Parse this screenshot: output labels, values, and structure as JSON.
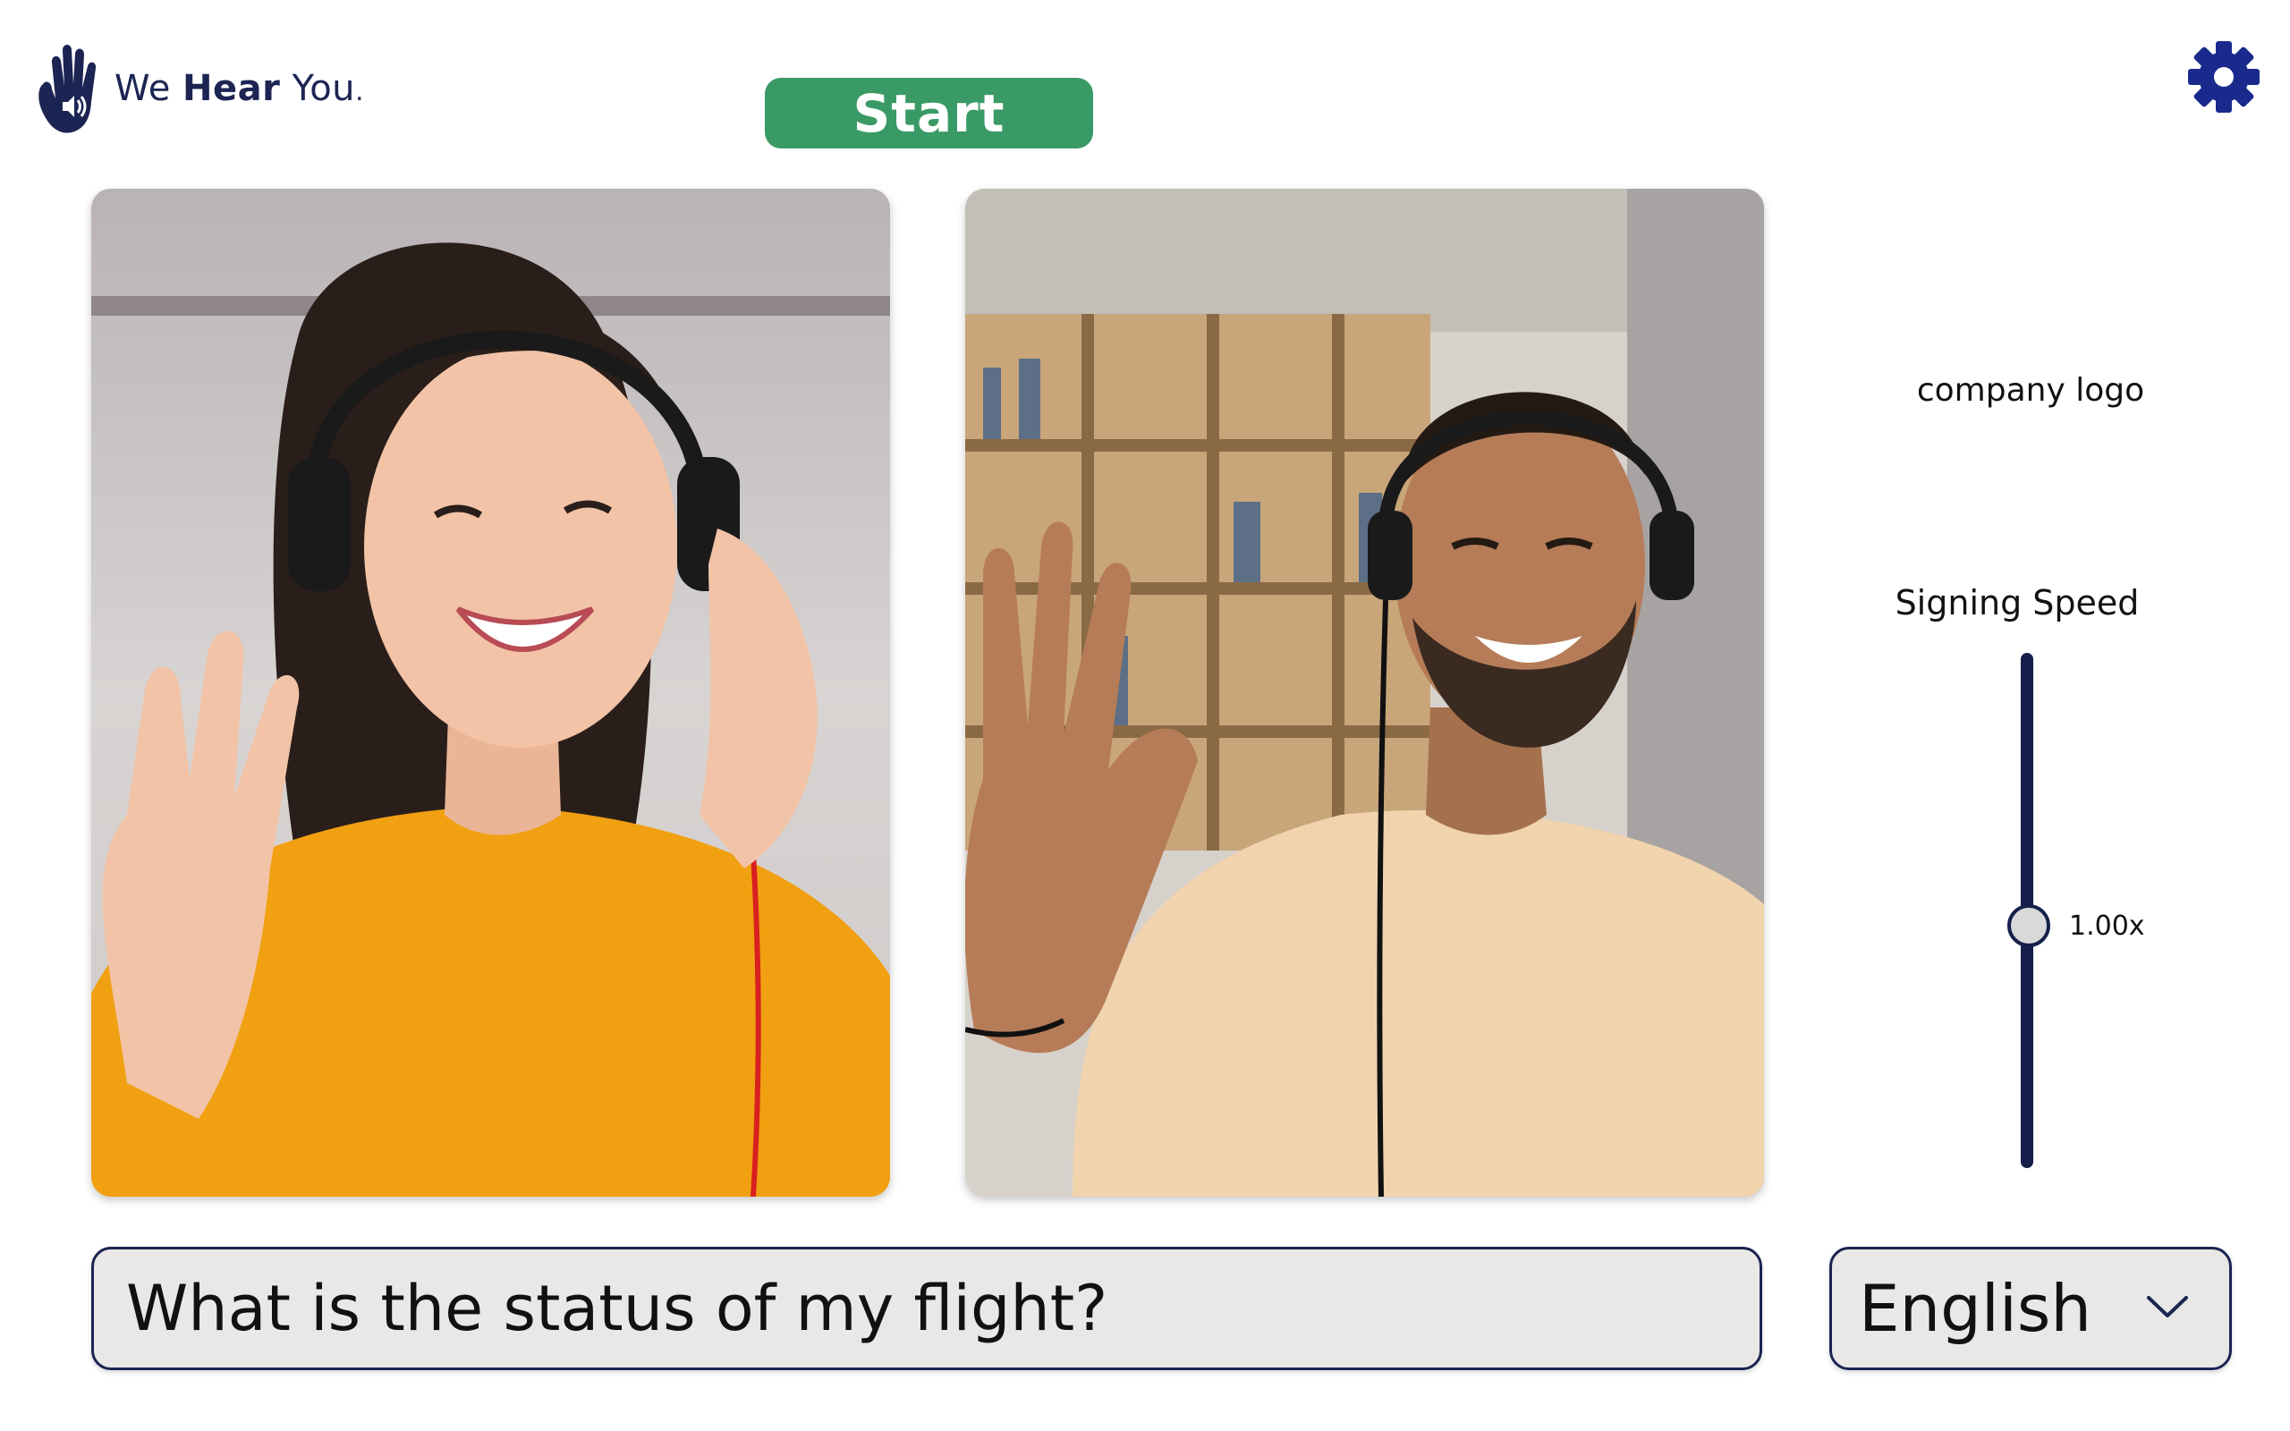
{
  "brand": {
    "name_prefix": "We ",
    "name_strong": "Hear",
    "name_suffix": " You",
    "name_dot": ".",
    "color": "#1b2452"
  },
  "toolbar": {
    "start_label": "Start",
    "start_color": "#3a9a66",
    "settings_icon": "gear-icon",
    "settings_color": "#1a2a8c"
  },
  "videos": {
    "left": {
      "description_icon": "video-feed-woman-headset"
    },
    "right": {
      "description_icon": "video-feed-man-headset"
    }
  },
  "side_panel": {
    "company_logo_label": "company logo",
    "speed_title": "Signing Speed",
    "speed_value": "1.00x",
    "speed_level_fraction": 0.47
  },
  "message": {
    "text": "What is the status of my flight?"
  },
  "language": {
    "selected": "English",
    "chevron_icon": "chevron-down-icon"
  }
}
